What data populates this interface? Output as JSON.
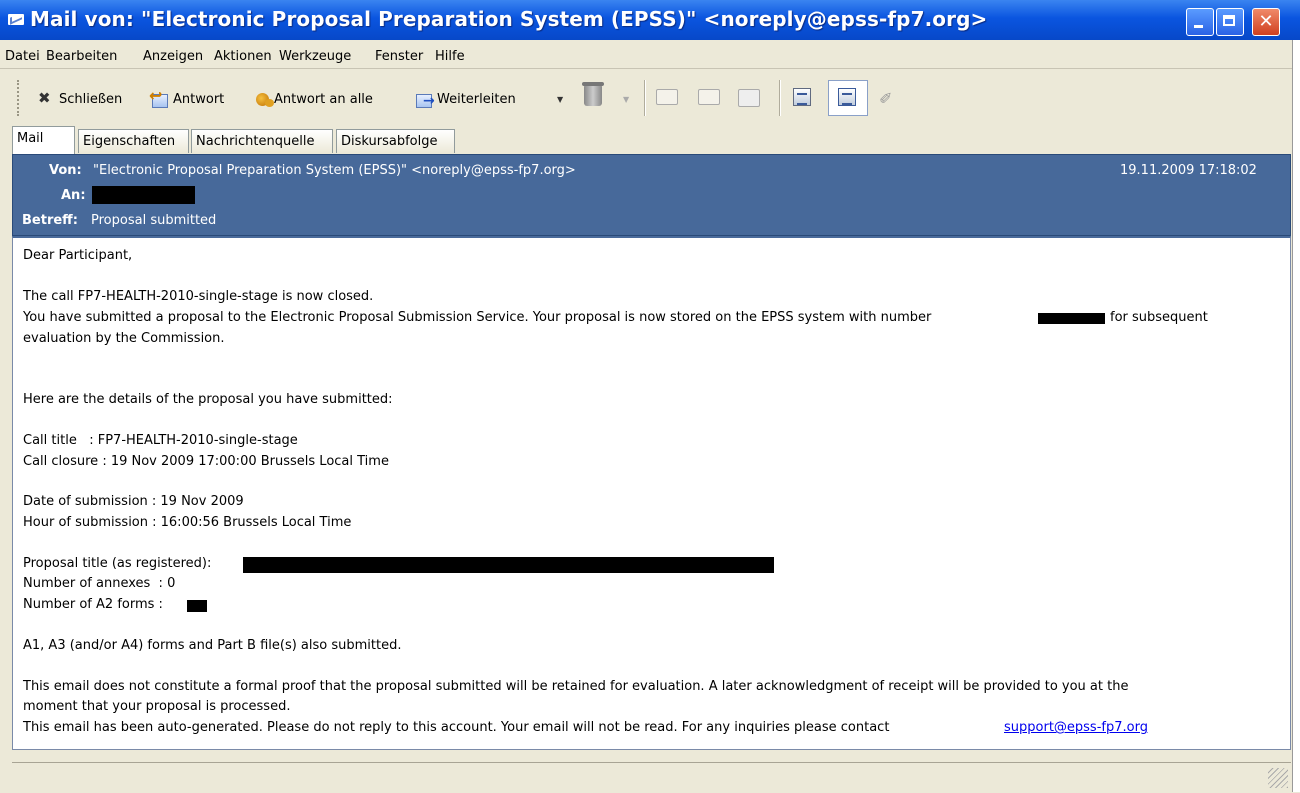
{
  "window": {
    "title": "Mail von: \"Electronic Proposal Preparation System (EPSS)\" <noreply@epss-fp7.org>",
    "buttons": [
      "minimize",
      "maximize",
      "close"
    ]
  },
  "menubar": [
    "Datei",
    "Bearbeiten",
    "Anzeigen",
    "Aktionen",
    "Werkzeuge",
    "Fenster",
    "Hilfe"
  ],
  "toolbar": {
    "close_label": "Schließen",
    "reply_label": "Antwort",
    "reply_all_label": "Antwort an alle",
    "forward_label": "Weiterleiten"
  },
  "tabs": [
    "Mail",
    "Eigenschaften",
    "Nachrichtenquelle",
    "Diskursabfolge"
  ],
  "header": {
    "from_label": "Von:",
    "from_value": "\"Electronic Proposal Preparation System (EPSS)\" <noreply@epss-fp7.org>",
    "date": "19.11.2009 17:18:02",
    "to_label": "An:",
    "subject_label": "Betreff:",
    "subject_value": "Proposal submitted"
  },
  "body": {
    "greeting": "Dear Participant,",
    "call_closed": "The call FP7-HEALTH-2010-single-stage is now closed.",
    "submitted_part1": "You have submitted a proposal to the Electronic Proposal Submission Service. Your proposal is now stored on the EPSS system with number",
    "submitted_part2": "for subsequent",
    "evaluation": "evaluation by the Commission.",
    "details_intro": "Here are the details of the proposal you have submitted:",
    "call_title": "Call title   : FP7-HEALTH-2010-single-stage",
    "call_closure": "Call closure : 19 Nov 2009 17:00:00 Brussels Local Time",
    "date_submission": "Date of submission : 19 Nov 2009",
    "hour_submission": "Hour of submission : 16:00:56 Brussels Local Time",
    "proposal_title": "Proposal title (as registered):",
    "annexes": "Number of annexes  : 0",
    "a2_forms": "Number of A2 forms :",
    "forms_submitted": "A1, A3 (and/or A4) forms and Part B file(s) also submitted.",
    "disclaimer1": "This email does not constitute a formal proof that the proposal submitted will be retained for evaluation. A later acknowledgment of receipt will be provided to you at the",
    "disclaimer2": "moment that your proposal is processed.",
    "autogen": "This email has been auto-generated. Please do not reply to this account. Your email will not be read. For any inquiries please contact",
    "support_link": "support@epss-fp7.org"
  }
}
